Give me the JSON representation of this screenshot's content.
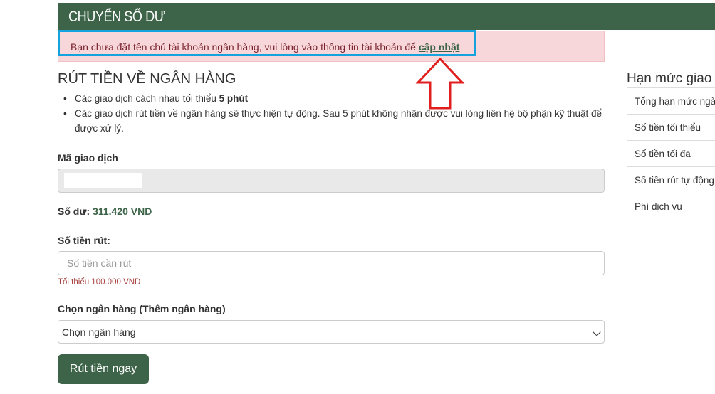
{
  "header": {
    "title": "CHUYỂN SỐ DƯ"
  },
  "alert": {
    "message": "Bạn chưa đặt tên chủ tài khoản ngân hàng, vui lòng vào thông tin tài khoản để ",
    "link_text": "cập nhật",
    "highlight_color": "#15a3e0",
    "arrow_color": "#e02020"
  },
  "withdraw": {
    "title": "RÚT TIỀN VỀ NGÂN HÀNG",
    "rule1_prefix": "Các giao dịch cách nhau tối thiểu ",
    "rule1_bold": "5 phút",
    "rule2": "Các giao dịch rút tiền về ngân hàng sẽ thực hiện tự động. Sau 5 phút không nhận được vui lòng liên hệ bộ phận kỹ thuật để được xử lý.",
    "txn_label": "Mã giao dịch",
    "balance_label": "Số dư: ",
    "balance_value": "311.420 VND",
    "amount_label": "Số tiền rút:",
    "amount_placeholder": "Số tiền cần rút",
    "amount_hint": "Tối thiểu 100.000 VND",
    "bank_label": "Chọn ngân hàng (Thêm ngân hàng)",
    "bank_selected": "Chọn ngân hàng",
    "submit_label": "Rút tiền ngay"
  },
  "limits": {
    "title": "Hạn mức giao",
    "rows": [
      "Tổng hạn mức ngà",
      "Số tiền tối thiểu",
      "Số tiền tối đa",
      "Số tiền rút tự động",
      "Phí dịch vụ"
    ]
  },
  "colors": {
    "brand": "#3d6448",
    "alert_bg": "#f8d7da"
  }
}
